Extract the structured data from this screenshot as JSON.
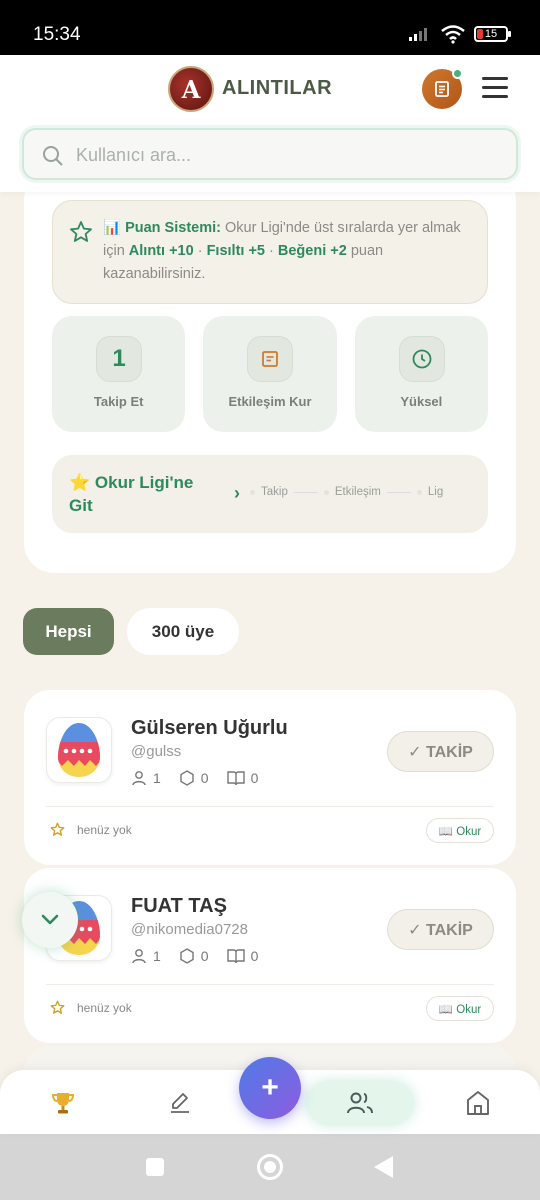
{
  "status_bar": {
    "time": "15:34",
    "battery": "15"
  },
  "header": {
    "brand": "ALINTILAR",
    "logo_letter": "A"
  },
  "search": {
    "placeholder": "Kullanıcı ara..."
  },
  "points_info": {
    "title": "📊 Puan Sistemi:",
    "text_1": " Okur Ligi'nde üst sıralarda yer almak için ",
    "alinti": "Alıntı +10",
    "dot_1": " · ",
    "fisilti": "Fısıltı +5",
    "dot_2": " · ",
    "begeni": "Beğeni +2",
    "text_2": " puan kazanabilirsiniz."
  },
  "steps": [
    {
      "number": "1",
      "label": "Takip Et"
    },
    {
      "label": "Etkileşim Kur"
    },
    {
      "label": "Yüksel"
    }
  ],
  "league": {
    "title": "⭐ Okur Ligi'ne Git",
    "arrow": "›",
    "progress": [
      "Takip",
      "Etkileşim",
      "Lig"
    ]
  },
  "filters": {
    "all": "Hepsi",
    "count": "300 üye"
  },
  "users": [
    {
      "name": "Gülseren Uğurlu",
      "handle": "@gulss",
      "followers": "1",
      "quotes": "0",
      "books": "0",
      "follow_label": "✓ TAKİP",
      "rank_text": "henüz yok",
      "badge": "📖 Okur"
    },
    {
      "name": "FUAT TAŞ",
      "handle": "@nikomedia0728",
      "followers": "1",
      "quotes": "0",
      "books": "0",
      "follow_label": "✓ TAKİP",
      "rank_text": "henüz yok",
      "badge": "📖 Okur"
    }
  ],
  "fab": {
    "add": "+"
  },
  "colors": {
    "accent_green": "#2e8a5c",
    "chip_dark": "#6b7c5e",
    "brand_red": "#8a231c"
  },
  "icons": [
    "signal-icon",
    "wifi-icon",
    "battery-icon",
    "search-icon",
    "star-outline-icon",
    "clock-icon",
    "note-icon",
    "user-icon",
    "hexagon-icon",
    "book-icon",
    "trophy-icon",
    "pen-icon",
    "users-icon",
    "home-icon",
    "chevron-down-icon"
  ]
}
